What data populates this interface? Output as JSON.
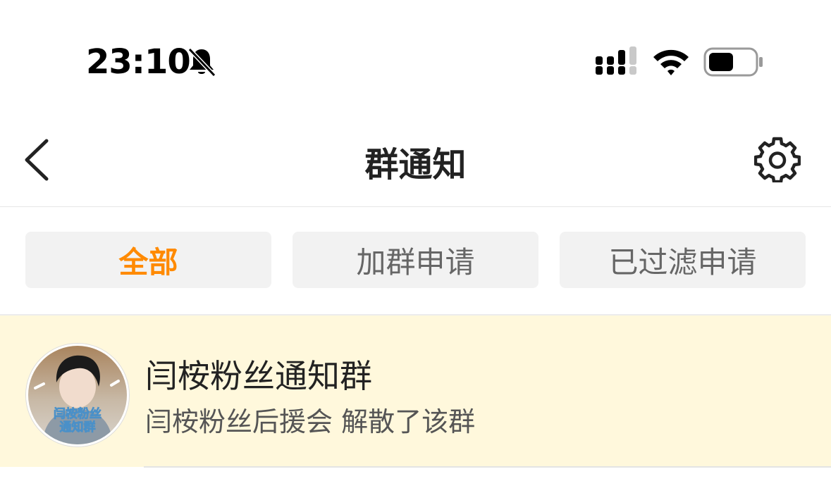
{
  "status_bar": {
    "time": "23:10",
    "icons": [
      "bell-slash-icon",
      "cellular-signal-icon",
      "wifi-icon",
      "battery-icon"
    ]
  },
  "nav": {
    "title": "群通知",
    "back_icon": "chevron-left-icon",
    "settings_icon": "gear-icon"
  },
  "tabs": [
    {
      "label": "全部",
      "active": true
    },
    {
      "label": "加群申请",
      "active": false
    },
    {
      "label": "已过滤申请",
      "active": false
    }
  ],
  "notifications": [
    {
      "group_name": "闫桉粉丝通知群",
      "description": "闫桉粉丝后援会 解散了该群",
      "avatar_caption": [
        "闫桉粉丝",
        "通知群"
      ]
    }
  ],
  "colors": {
    "accent": "#ff8a00",
    "row_highlight": "#fff8dc",
    "tab_bg": "#f2f2f2"
  }
}
